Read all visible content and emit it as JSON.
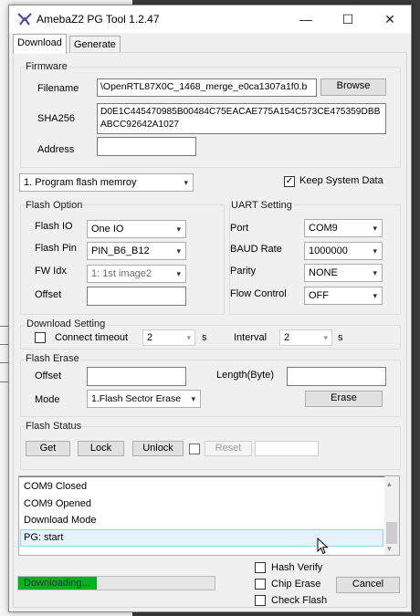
{
  "window": {
    "title": "AmebaZ2 PG Tool 1.2.47"
  },
  "titlebar_buttons": {
    "minimize": "—",
    "maximize": "☐",
    "close": "✕"
  },
  "tabs": [
    {
      "label": "Download"
    },
    {
      "label": "Generate"
    }
  ],
  "firmware": {
    "group": "Firmware",
    "filename_label": "Filename",
    "filename_value": "\\OpenRTL87X0C_1468_merge_e0ca1307a1f0.b",
    "browse": "Browse",
    "sha_label": "SHA256",
    "sha_value": "D0E1C445470985B00484C75EACAE775A154C573CE475359DBBABCC92642A1027",
    "address_label": "Address",
    "address_value": ""
  },
  "mode": {
    "selected": "1. Program flash memroy",
    "keep_label": "Keep System Data",
    "keep_checked": true
  },
  "flash_option": {
    "group": "Flash Option",
    "io_label": "Flash IO",
    "io_value": "One IO",
    "pin_label": "Flash Pin",
    "pin_value": "PIN_B6_B12",
    "fw_label": "FW Idx",
    "fw_value": "1: 1st image2",
    "offset_label": "Offset",
    "offset_value": ""
  },
  "uart": {
    "group": "UART Setting",
    "port_label": "Port",
    "port_value": "COM9",
    "baud_label": "BAUD Rate",
    "baud_value": "1000000",
    "parity_label": "Parity",
    "parity_value": "NONE",
    "flow_label": "Flow Control",
    "flow_value": "OFF"
  },
  "download_setting": {
    "group": "Download Setting",
    "timeout_label": "Connect timeout",
    "timeout_checked": false,
    "timeout_value": "2",
    "timeout_unit": "s",
    "interval_label": "Interval",
    "interval_value": "2",
    "interval_unit": "s"
  },
  "flash_erase": {
    "group": "Flash Erase",
    "offset_label": "Offset",
    "offset_value": "",
    "length_label": "Length(Byte)",
    "length_value": "",
    "mode_label": "Mode",
    "mode_value": "1.Flash Sector Erase",
    "erase": "Erase"
  },
  "flash_status": {
    "group": "Flash Status",
    "get": "Get",
    "lock": "Lock",
    "unlock": "Unlock",
    "reset": "Reset",
    "value": ""
  },
  "log": {
    "lines": [
      "COM9 Closed",
      "COM9 Opened",
      "Download Mode",
      "PG: start"
    ],
    "selected_index": 3
  },
  "progress": {
    "text": "Downloading...",
    "percent": 40
  },
  "options": {
    "hash_verify": "Hash Verify",
    "chip_erase": "Chip Erase",
    "check_flash": "Check Flash"
  },
  "cancel": "Cancel",
  "colors": {
    "progress_fill": "#06b025",
    "selection_bg": "#e5f3ff",
    "selection_border": "#99d1ff"
  },
  "icons": {
    "dropdown": "▾",
    "scroll_up": "▴",
    "scroll_down": "▾",
    "check": "✓"
  }
}
